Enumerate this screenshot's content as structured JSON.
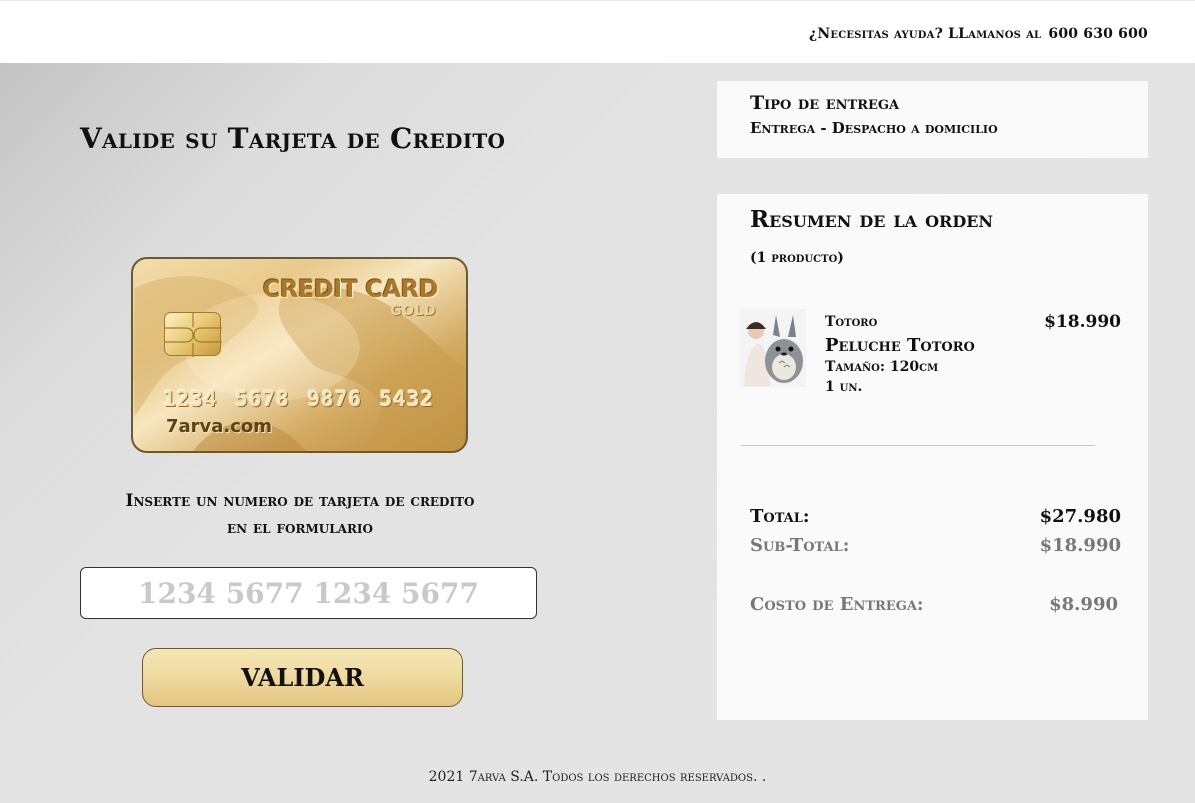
{
  "header": {
    "help_text": "¿Necesitas ayuda?  LLamanos al",
    "phone": "600 630 600"
  },
  "main": {
    "title": "Valide su Tarjeta de Credito",
    "card": {
      "label": "CREDIT CARD",
      "tier": "GOLD",
      "number": "1234 5678 9876 5432",
      "brand": "7arva.com"
    },
    "instructions_line1": "Inserte un numero de tarjeta de  credito",
    "instructions_line2": "en el formulario",
    "input": {
      "placeholder": "1234 5677 1234 5677",
      "value": ""
    },
    "validate_label": "VALIDAR"
  },
  "delivery": {
    "title": "Tipo de entrega",
    "value": "Entrega - Despacho a domicilio"
  },
  "summary": {
    "title": "Resumen de la orden",
    "count": "(1 producto)",
    "product": {
      "brand": "Totoro",
      "name": "Peluche Totoro",
      "size": "Tamaño: 120cm",
      "qty": "1 un.",
      "price": "$18.990"
    },
    "total_label": "Total:",
    "total_value": "$27.980",
    "subtotal_label": "Sub-Total:",
    "subtotal_value": "$18.990",
    "shipping_label": "Costo de Entrega:",
    "shipping_value": "$8.990"
  },
  "footer": {
    "text": "2021   7arva S.A. Todos los derechos reservados.   ."
  }
}
